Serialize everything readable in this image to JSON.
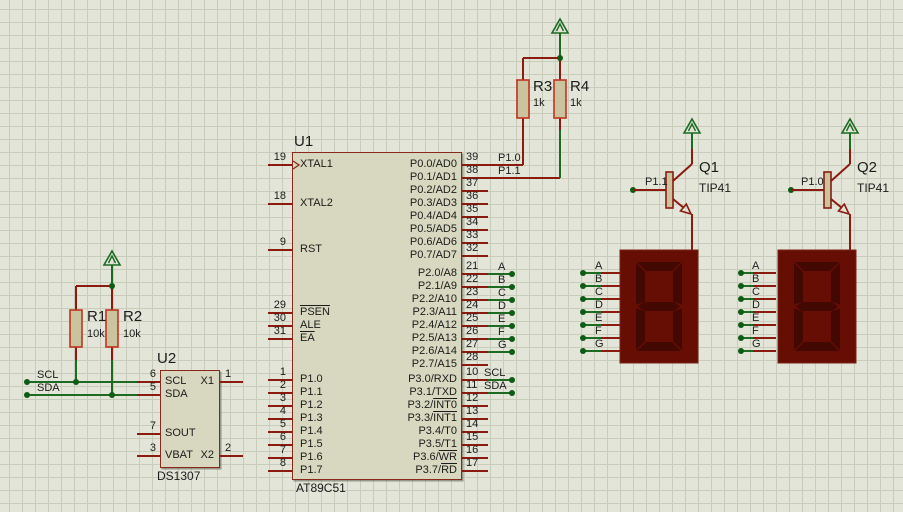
{
  "colors": {
    "background": "#e2e5d8",
    "grid": "#c7ccbb",
    "wire_red": "#8b1a0f",
    "wire_green": "#1d6b22",
    "junction_dot": "#0f5a14",
    "component_border": "#8a281c",
    "component_fill": "#d7d8bf",
    "resistor_border": "#c03420",
    "resistor_fill": "#c9c49e",
    "display_body": "#660d04",
    "display_segment": "#430802",
    "text": "#1c1c1c"
  },
  "u1": {
    "ref": "U1",
    "part": "AT89C51",
    "left_pins": [
      {
        "num": "19",
        "label": "XTAL1"
      },
      {
        "num": "18",
        "label": "XTAL2"
      },
      {
        "num": "9",
        "label": "RST"
      },
      {
        "num": "29",
        "pre": "",
        "ov": "PSEN"
      },
      {
        "num": "30",
        "label": "ALE"
      },
      {
        "num": "31",
        "pre": "",
        "ov": "EA"
      },
      {
        "num": "1",
        "label": "P1.0"
      },
      {
        "num": "2",
        "label": "P1.1"
      },
      {
        "num": "3",
        "label": "P1.2"
      },
      {
        "num": "4",
        "label": "P1.3"
      },
      {
        "num": "5",
        "label": "P1.4"
      },
      {
        "num": "6",
        "label": "P1.5"
      },
      {
        "num": "7",
        "label": "P1.6"
      },
      {
        "num": "8",
        "label": "P1.7"
      }
    ],
    "right_pins": [
      {
        "num": "39",
        "label": "P0.0/AD0",
        "net": "P1.0"
      },
      {
        "num": "38",
        "label": "P0.1/AD1",
        "net": "P1.1"
      },
      {
        "num": "37",
        "label": "P0.2/AD2"
      },
      {
        "num": "36",
        "label": "P0.3/AD3"
      },
      {
        "num": "35",
        "label": "P0.4/AD4"
      },
      {
        "num": "34",
        "label": "P0.5/AD5"
      },
      {
        "num": "33",
        "label": "P0.6/AD6"
      },
      {
        "num": "32",
        "label": "P0.7/AD7"
      },
      {
        "num": "21",
        "label": "P2.0/A8",
        "net": "A"
      },
      {
        "num": "22",
        "label": "P2.1/A9",
        "net": "B"
      },
      {
        "num": "23",
        "label": "P2.2/A10",
        "net": "C"
      },
      {
        "num": "24",
        "label": "P2.3/A11",
        "net": "D"
      },
      {
        "num": "25",
        "label": "P2.4/A12",
        "net": "E"
      },
      {
        "num": "26",
        "label": "P2.5/A13",
        "net": "F"
      },
      {
        "num": "27",
        "label": "P2.6/A14",
        "net": "G"
      },
      {
        "num": "28",
        "label": "P2.7/A15"
      },
      {
        "num": "10",
        "label": "P3.0/RXD",
        "net": "SCL"
      },
      {
        "num": "11",
        "label": "P3.1/TXD",
        "net": "SDA"
      },
      {
        "num": "12",
        "pre": "P3.2/",
        "ov": "INT0"
      },
      {
        "num": "13",
        "pre": "P3.3/",
        "ov": "INT1"
      },
      {
        "num": "14",
        "label": "P3.4/T0"
      },
      {
        "num": "15",
        "label": "P3.5/T1"
      },
      {
        "num": "16",
        "pre": "P3.6/",
        "ov": "WR"
      },
      {
        "num": "17",
        "pre": "P3.7/",
        "ov": "RD"
      }
    ]
  },
  "u2": {
    "ref": "U2",
    "part": "DS1307",
    "left_pins": [
      {
        "num": "6",
        "label": "SCL"
      },
      {
        "num": "5",
        "label": "SDA"
      },
      {
        "num": "7",
        "label": "SOUT"
      },
      {
        "num": "3",
        "label": "VBAT"
      }
    ],
    "right_pins": [
      {
        "num": "1",
        "label": "X1"
      },
      {
        "num": "2",
        "label": "X2"
      }
    ]
  },
  "resistors": [
    {
      "ref": "R1",
      "value": "10k"
    },
    {
      "ref": "R2",
      "value": "10k"
    },
    {
      "ref": "R3",
      "value": "1k"
    },
    {
      "ref": "R4",
      "value": "1k"
    }
  ],
  "transistors": [
    {
      "ref": "Q1",
      "value": "TIP41",
      "base_net": "P1.1"
    },
    {
      "ref": "Q2",
      "value": "TIP41",
      "base_net": "P1.0"
    }
  ],
  "displays": [
    {
      "segment_pins": [
        "A",
        "B",
        "C",
        "D",
        "E",
        "F",
        "G"
      ]
    },
    {
      "segment_pins": [
        "A",
        "B",
        "C",
        "D",
        "E",
        "F",
        "G"
      ]
    }
  ],
  "nets": {
    "scl": "SCL",
    "sda": "SDA"
  }
}
